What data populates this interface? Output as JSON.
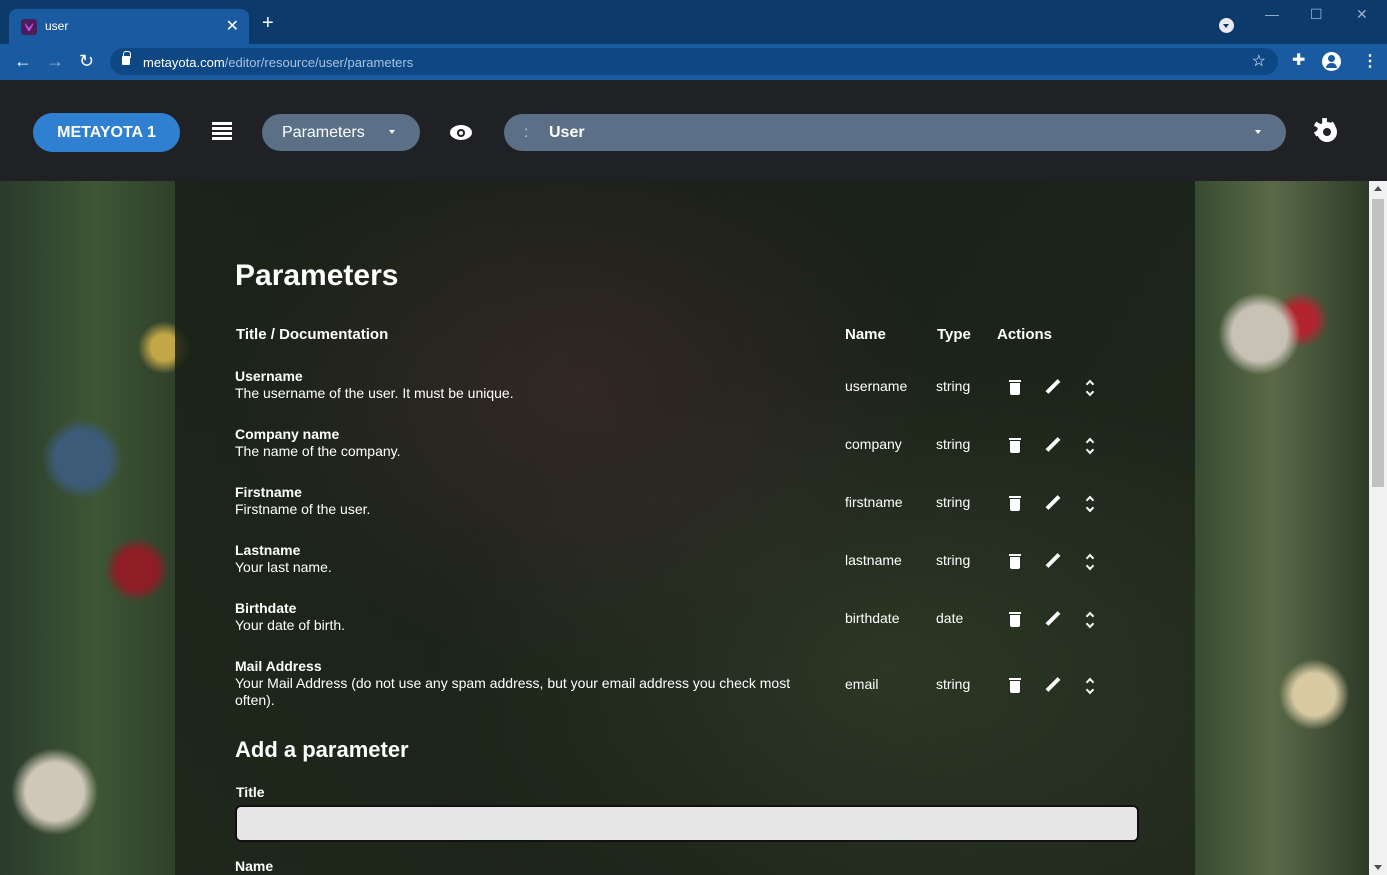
{
  "browser": {
    "tab_title": "user",
    "tab_close": "✕",
    "new_tab": "+",
    "url_domain": "metayota.com",
    "url_path": "/editor/resource/user/parameters",
    "window_controls": [
      "—",
      "☐",
      "✕"
    ]
  },
  "appbar": {
    "brand": "METAYOTA 1",
    "section_select": "Parameters",
    "resource_prefix": ":",
    "resource_select": "User"
  },
  "main": {
    "heading": "Parameters",
    "columns": {
      "title": "Title / Documentation",
      "name": "Name",
      "type": "Type",
      "actions": "Actions"
    },
    "rows": [
      {
        "title": "Username",
        "doc": "The username of the user. It must be unique.",
        "name": "username",
        "type": "string"
      },
      {
        "title": "Company name",
        "doc": "The name of the company.",
        "name": "company",
        "type": "string"
      },
      {
        "title": "Firstname",
        "doc": "Firstname of the user.",
        "name": "firstname",
        "type": "string"
      },
      {
        "title": "Lastname",
        "doc": "Your last name.",
        "name": "lastname",
        "type": "string"
      },
      {
        "title": "Birthdate",
        "doc": "Your date of birth.",
        "name": "birthdate",
        "type": "date"
      },
      {
        "title": "Mail Address",
        "doc": "Your Mail Address (do not use any spam address, but your email address you check most often).",
        "name": "email",
        "type": "string"
      }
    ],
    "add_heading": "Add a parameter",
    "title_label": "Title",
    "title_value": "",
    "name_label": "Name"
  }
}
